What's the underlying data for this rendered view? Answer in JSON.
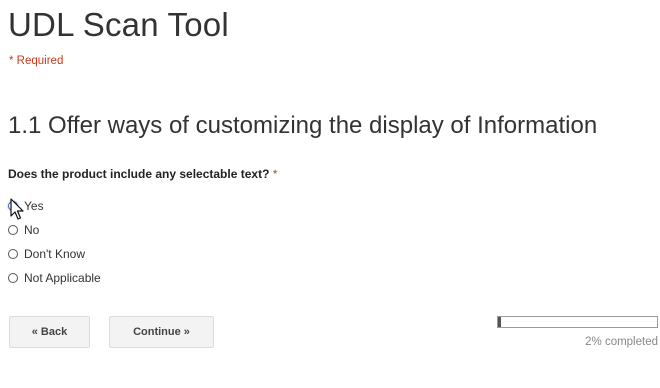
{
  "form": {
    "title": "UDL Scan Tool",
    "required_note": "* Required"
  },
  "section": {
    "title": "1.1 Offer ways of customizing the display of Information"
  },
  "question": {
    "text": "Does the product include any selectable text?",
    "required_marker": "*",
    "options": [
      {
        "label": "Yes",
        "selected": false
      },
      {
        "label": "No",
        "selected": false
      },
      {
        "label": "Don't Know",
        "selected": false
      },
      {
        "label": "Not Applicable",
        "selected": false
      }
    ]
  },
  "navigation": {
    "back_label": "« Back",
    "continue_label": "Continue »"
  },
  "progress": {
    "percent": 2,
    "label": "2% completed"
  },
  "colors": {
    "required_red": "#c43b1d",
    "button_bg": "#f3f3f3",
    "progress_fill": "#555555"
  }
}
